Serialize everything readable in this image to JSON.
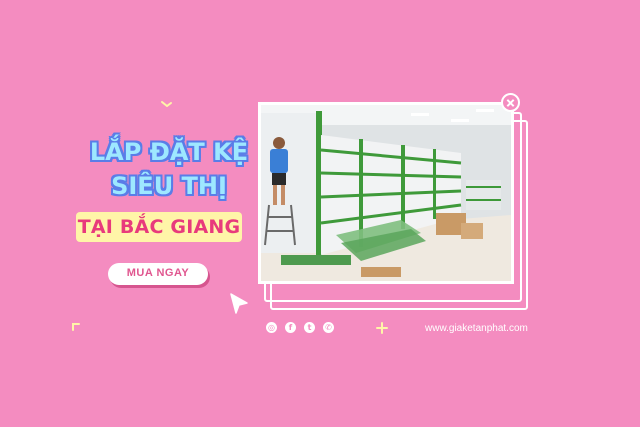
{
  "banner": {
    "title_line1": "LẮP ĐẶT KỆ",
    "title_line2": "SIÊU THỊ",
    "subtitle": "TẠI BẮC GIANG",
    "cta_label": "MUA NGAY",
    "website": "www.giaketanphat.com"
  },
  "social_icons": [
    "instagram-icon",
    "facebook-icon",
    "twitter-icon",
    "whatsapp-icon"
  ],
  "colors": {
    "background": "#f48cc0",
    "title_fill": "#9ee8ff",
    "title_outline": "#5a7de8",
    "subtitle_bg": "#fff5a8",
    "subtitle_text": "#e83a7c",
    "shelf_green": "#3f9a3a"
  }
}
